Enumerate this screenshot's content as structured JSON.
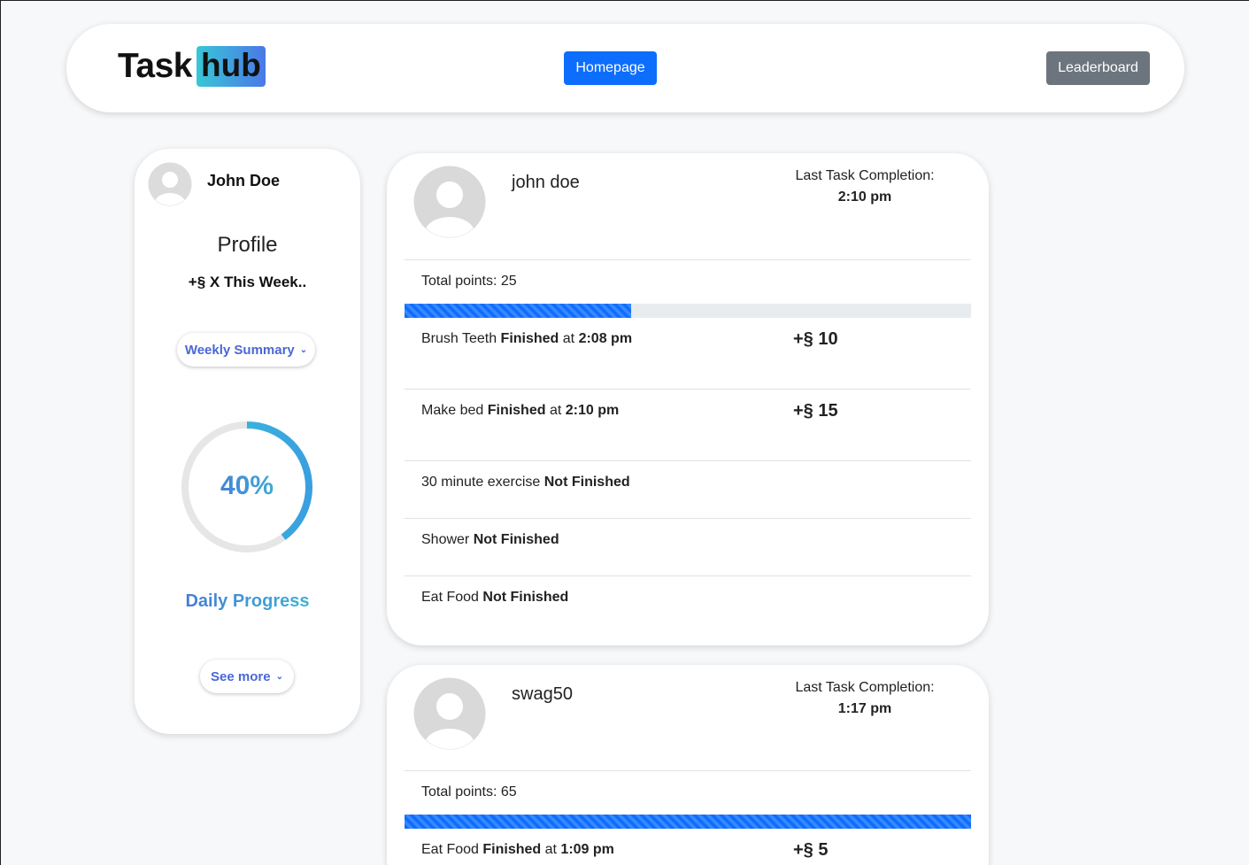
{
  "header": {
    "logo_task": "Task",
    "logo_hub": "hub",
    "home_label": "Homepage",
    "leaderboard_label": "Leaderboard"
  },
  "profile": {
    "name": "John Doe",
    "title": "Profile",
    "week_text": "+§ X This Week..",
    "weekly_summary_label": "Weekly Summary",
    "progress_percent": 40,
    "progress_label": "40%",
    "daily_progress_label": "Daily Progress",
    "see_more_label": "See more"
  },
  "feed": [
    {
      "user": "john doe",
      "last_label": "Last Task Completion:",
      "last_time": "2:10 pm",
      "total_label": "Total points: 25",
      "progress_fraction": 0.4,
      "tasks": [
        {
          "name": "Brush Teeth",
          "status": "Finished",
          "at": "at",
          "time": "2:08 pm",
          "points": "+§ 10"
        },
        {
          "name": "Make bed",
          "status": "Finished",
          "at": "at",
          "time": "2:10 pm",
          "points": "+§ 15"
        },
        {
          "name": "30 minute exercise",
          "status": "Not Finished"
        },
        {
          "name": "Shower",
          "status": "Not Finished"
        },
        {
          "name": "Eat Food",
          "status": "Not Finished"
        }
      ]
    },
    {
      "user": "swag50",
      "last_label": "Last Task Completion:",
      "last_time": "1:17 pm",
      "total_label": "Total points: 65",
      "progress_fraction": 1.0,
      "tasks": [
        {
          "name": "Eat Food",
          "status": "Finished",
          "at": "at",
          "time": "1:09 pm",
          "points": "+§ 5"
        }
      ]
    }
  ],
  "colors": {
    "primary": "#0d6efd",
    "secondary": "#6c757d",
    "gradient_start": "#4a67d6",
    "gradient_end": "#38c7d6"
  }
}
